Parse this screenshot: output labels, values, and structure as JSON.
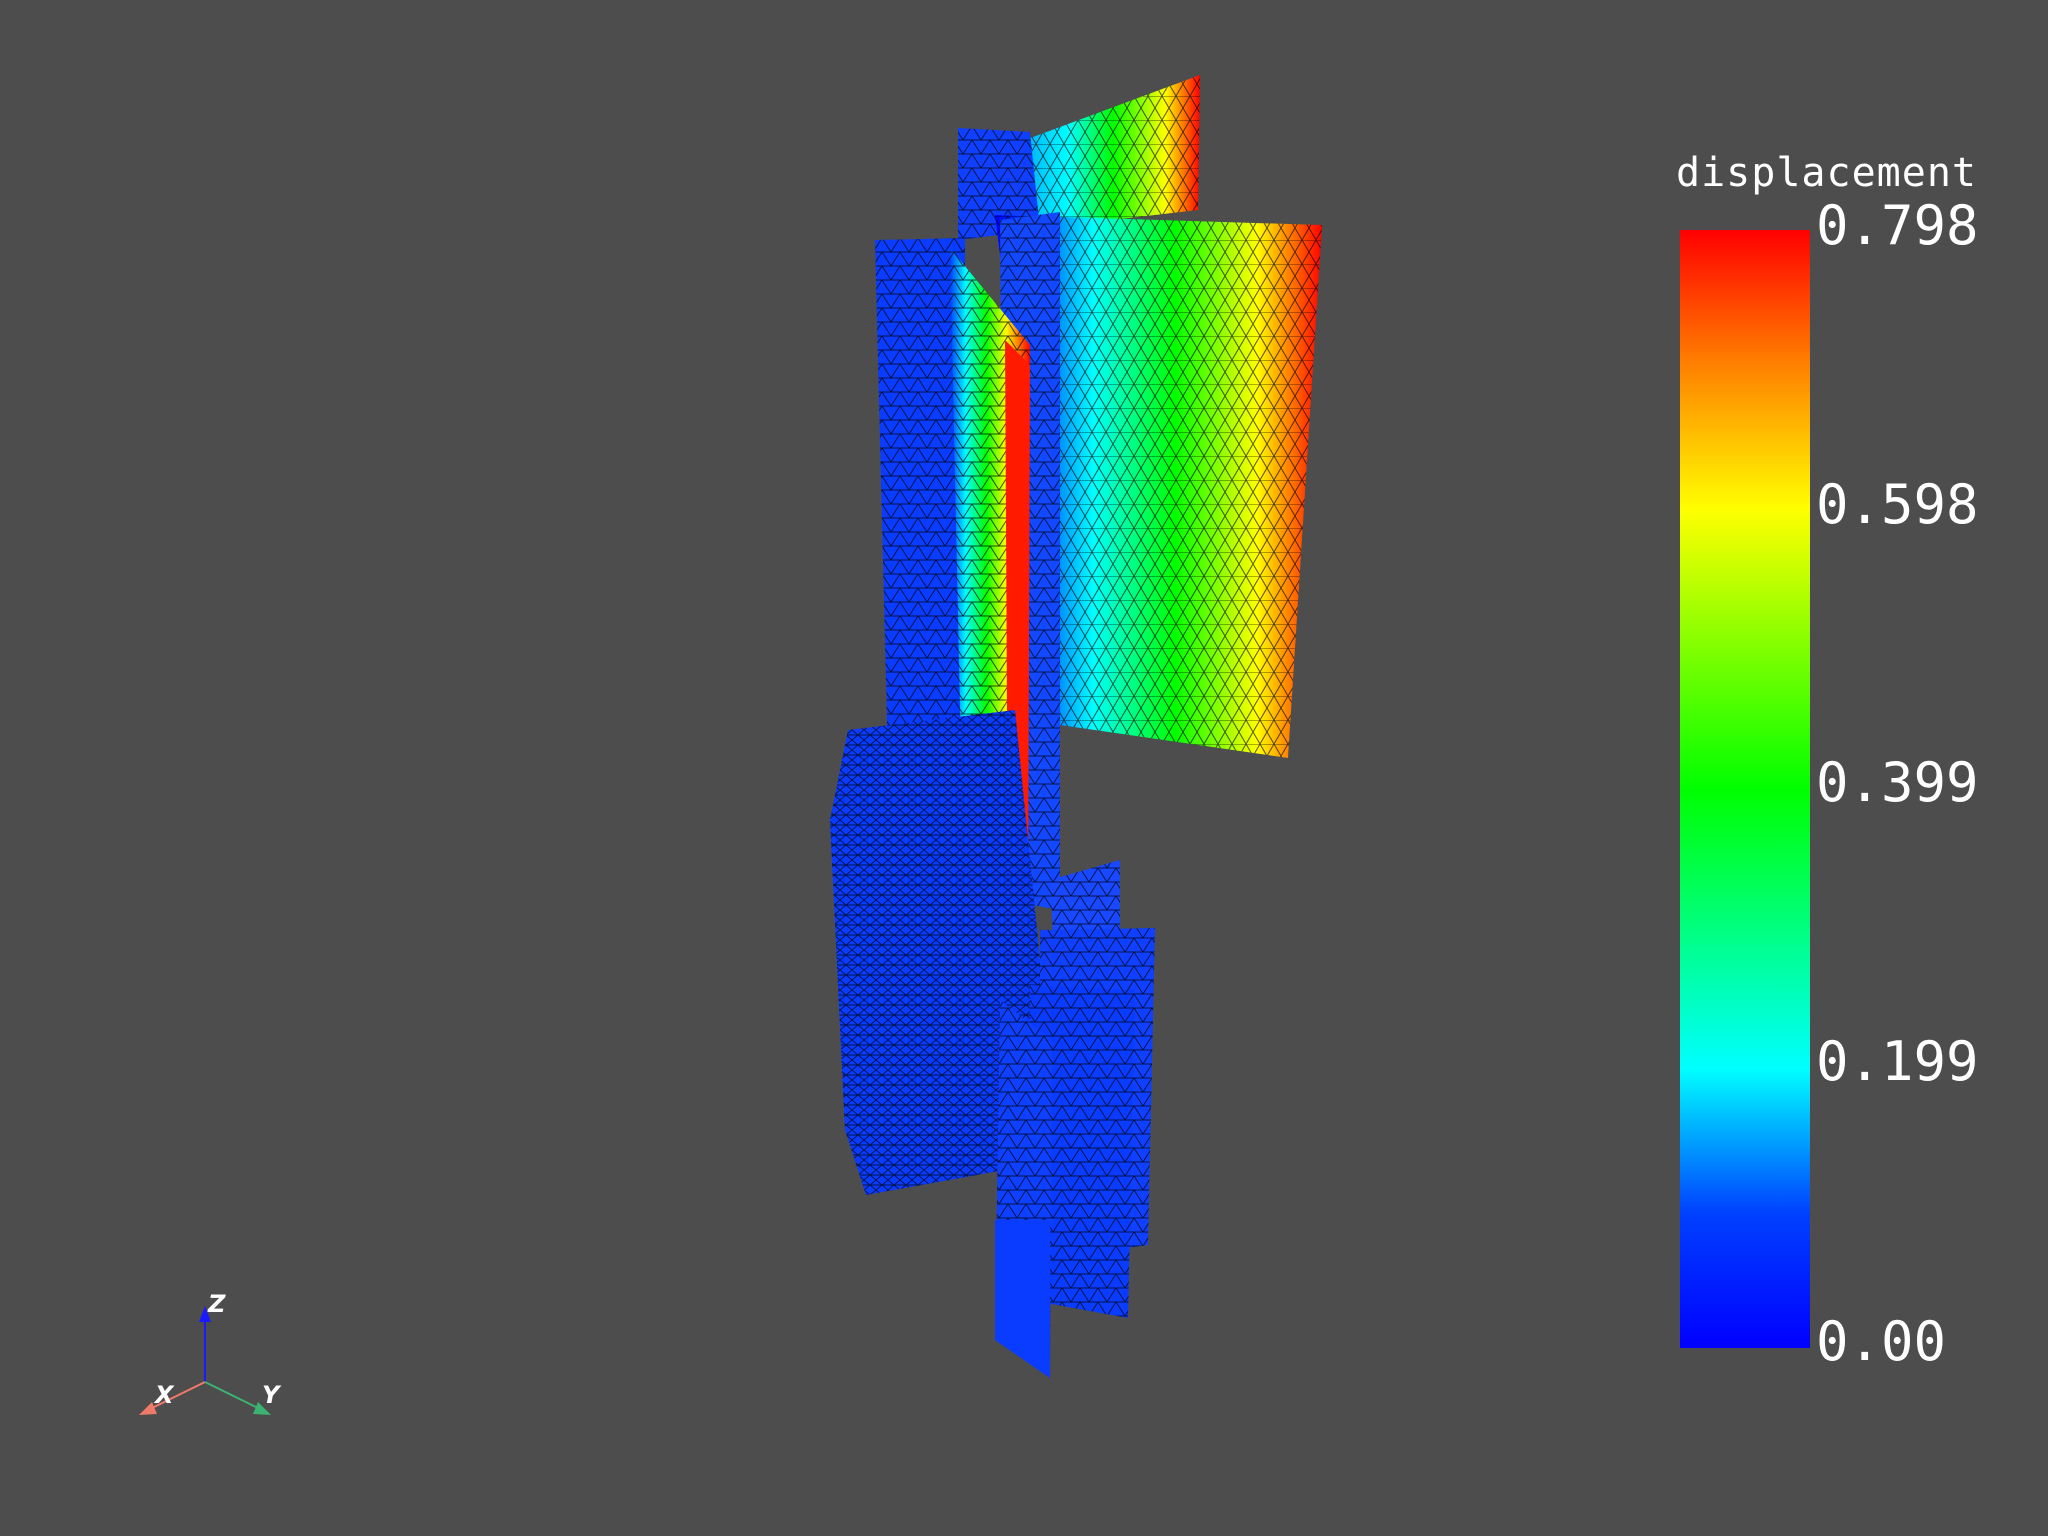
{
  "scalar_bar": {
    "title": "displacement",
    "labels": [
      "0.798",
      "0.598",
      "0.399",
      "0.199",
      "0.00"
    ]
  },
  "axes": {
    "x": "X",
    "y": "Y",
    "z": "Z"
  },
  "colors": {
    "background": "#4d4d4d",
    "colormap": [
      "#0000ff",
      "#00ffff",
      "#00ff00",
      "#ffff00",
      "#ff0000"
    ],
    "x_axis": "#ef7a6a",
    "y_axis": "#3cb371",
    "z_axis": "#1a1aff"
  }
}
